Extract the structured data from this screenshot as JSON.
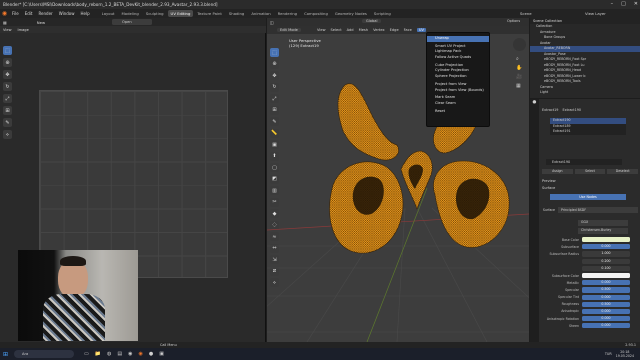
{
  "window": {
    "title": "Blender* [C:\\Users\\MSI\\Downloads\\body_reborn_1.2_BETA_DevKit_blender_2.93_Avastar_2.93.3.blend]"
  },
  "menubar": {
    "items": [
      "File",
      "Edit",
      "Render",
      "Window",
      "Help"
    ],
    "workspaces": [
      "Layout",
      "Modeling",
      "Sculpting",
      "UV Editing",
      "Texture Paint",
      "Shading",
      "Animation",
      "Rendering",
      "Compositing",
      "Geometry Nodes",
      "Scripting"
    ],
    "active_workspace": "UV Editing",
    "scene_label": "Scene",
    "view_layer_label": "View Layer"
  },
  "uv_editor": {
    "header_items": [
      "View",
      "Image"
    ],
    "image_button": "Open",
    "new_button": "New"
  },
  "viewport": {
    "mode": "Edit Mode",
    "menus": [
      "View",
      "Select",
      "Add",
      "Mesh",
      "Vertex",
      "Edge",
      "Face",
      "UV"
    ],
    "orientation": "Global",
    "options_label": "Options",
    "view_name": "User Perspective",
    "object_label": "(129) Extract19"
  },
  "uv_menu": {
    "title": "Unwrap",
    "items": [
      "Unwrap",
      "Smart UV Project",
      "Lightmap Pack",
      "Follow Active Quads",
      "Cube Projection",
      "Cylinder Projection",
      "Sphere Projection",
      "Project from View",
      "Project from View (Bounds)",
      "Mark Seam",
      "Clear Seam",
      "Reset"
    ],
    "separators_after": [
      0,
      3,
      6,
      8,
      10
    ]
  },
  "outliner": {
    "title": "Scene Collection",
    "rows": [
      "Collection",
      "Armature",
      "Bone Groups",
      "Avatar",
      "Avatar_REBORN",
      "Avastar_Pose",
      "eBODY_REBORN_Foot Spr",
      "eBODY_REBORN_Foot Lu",
      "eBODY_REBORN_Head",
      "eBODY_REBORN_Lower b",
      "eBODY_REBORN_Tools",
      "Camera",
      "Light"
    ],
    "selected_index": 4
  },
  "properties": {
    "object_name": "Extract19",
    "material_name": "Extract190",
    "materials": [
      "Extract190",
      "Extract189",
      "Extract191"
    ],
    "slot_name": "Extract190",
    "buttons": [
      "Assign",
      "Select",
      "Deselect"
    ],
    "sections": [
      "Preview",
      "Surface"
    ],
    "use_nodes_label": "Use Nodes",
    "surface_label": "Surface",
    "surface_value": "Principled BSDF",
    "distribution": "GGX",
    "subsurface_method": "Christensen-Burley",
    "rows": [
      {
        "label": "Base Color",
        "value": "",
        "style": "color"
      },
      {
        "label": "Subsurface",
        "value": "0.000",
        "style": "blue"
      },
      {
        "label": "Subsurface Radius",
        "value": "1.000",
        "style": "dark"
      },
      {
        "label": "",
        "value": "0.200",
        "style": "dark"
      },
      {
        "label": "",
        "value": "0.100",
        "style": "dark"
      },
      {
        "label": "Subsurface Color",
        "value": "",
        "style": "white"
      },
      {
        "label": "Metallic",
        "value": "0.000",
        "style": "blue"
      },
      {
        "label": "Specular",
        "value": "0.500",
        "style": "blue"
      },
      {
        "label": "Specular Tint",
        "value": "0.000",
        "style": "blue"
      },
      {
        "label": "Roughness",
        "value": "0.500",
        "style": "blue"
      },
      {
        "label": "Anisotropic",
        "value": "0.000",
        "style": "blue"
      },
      {
        "label": "Anisotropic Rotation",
        "value": "0.000",
        "style": "blue"
      },
      {
        "label": "Sheen",
        "value": "0.000",
        "style": "blue"
      }
    ],
    "base_color": "#e8f2c8",
    "accent": "#4772b3"
  },
  "statusbar": {
    "left": "Call Menu",
    "version": "2.93.1"
  },
  "taskbar": {
    "search_text": "Ara",
    "time": "20:18",
    "date": "19.05.2024",
    "lang": "TUR"
  },
  "colors": {
    "mesh_orange": "#f39c1a",
    "viewport_bg": "#3d3d3d",
    "highlight": "#4772b3"
  }
}
